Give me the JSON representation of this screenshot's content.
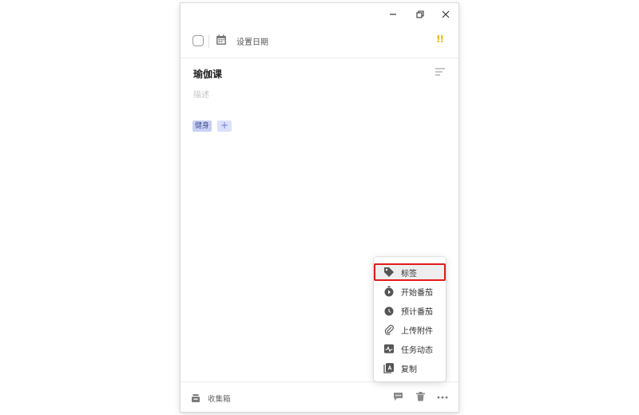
{
  "toolbar": {
    "date_placeholder": "设置日期",
    "priority_marks": "!!"
  },
  "task": {
    "title": "瑜伽课",
    "description_placeholder": "描述"
  },
  "tags": {
    "items": [
      "健身"
    ],
    "add_symbol": "+"
  },
  "footer": {
    "project_label": "收集箱"
  },
  "menu": {
    "items": [
      {
        "label": "标签",
        "icon": "tag-icon",
        "highlighted": true
      },
      {
        "label": "开始番茄",
        "icon": "timer-play-icon"
      },
      {
        "label": "预计番茄",
        "icon": "tomato-icon"
      },
      {
        "label": "上传附件",
        "icon": "paperclip-icon"
      },
      {
        "label": "任务动态",
        "icon": "activity-icon"
      },
      {
        "label": "复制",
        "icon": "duplicate-icon"
      }
    ]
  },
  "colors": {
    "priority": "#f2b600",
    "tag_bg": "#c7d0f5",
    "highlight_border": "#e21b1b"
  }
}
